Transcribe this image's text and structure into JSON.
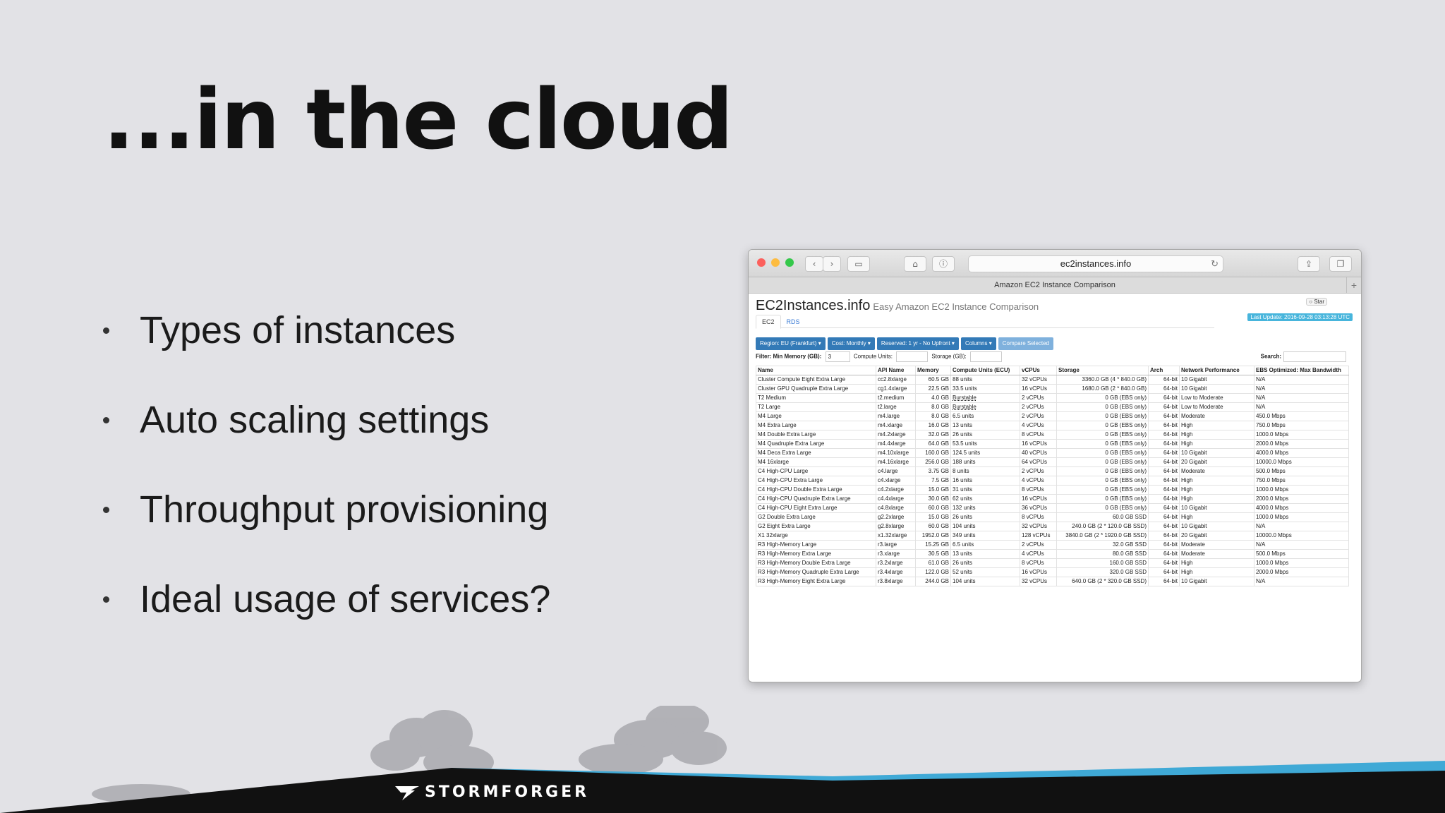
{
  "slide": {
    "title": "...in the cloud",
    "bullets": [
      "Types of instances",
      "Auto scaling settings",
      "Throughput provisioning",
      "Ideal usage of services?"
    ]
  },
  "browser": {
    "url": "ec2instances.info",
    "tab_title": "Amazon EC2 Instance Comparison",
    "site_title": "EC2Instances.info",
    "site_subtitle": "Easy Amazon EC2 Instance Comparison",
    "star_label": "Star",
    "last_update": "Last Update: 2016-09-28 03:13:28 UTC",
    "tabs": [
      "EC2",
      "RDS"
    ],
    "buttons": [
      "Region: EU (Frankfurt) ▾",
      "Cost: Monthly ▾",
      "Reserved: 1 yr - No Upfront ▾",
      "Columns ▾",
      "Compare Selected"
    ],
    "filter": {
      "label": "Filter: Min Memory (GB):",
      "min_memory_value": "3",
      "compute_units_label": "Compute Units:",
      "storage_label": "Storage (GB):",
      "search_label": "Search:"
    },
    "table": {
      "headers": [
        "Name",
        "API Name",
        "Memory",
        "Compute Units (ECU)",
        "vCPUs",
        "Storage",
        "Arch",
        "Network Performance",
        "EBS Optimized: Max Bandwidth"
      ],
      "rows": [
        [
          "Cluster Compute Eight Extra Large",
          "cc2.8xlarge",
          "60.5 GB",
          "88 units",
          "32 vCPUs",
          "3360.0 GB (4 * 840.0 GB)",
          "64-bit",
          "10 Gigabit",
          "N/A"
        ],
        [
          "Cluster GPU Quadruple Extra Large",
          "cg1.4xlarge",
          "22.5 GB",
          "33.5 units",
          "16 vCPUs",
          "1680.0 GB (2 * 840.0 GB)",
          "64-bit",
          "10 Gigabit",
          "N/A"
        ],
        [
          "T2 Medium",
          "t2.medium",
          "4.0 GB",
          "Burstable",
          "2 vCPUs",
          "0 GB (EBS only)",
          "64-bit",
          "Low to Moderate",
          "N/A"
        ],
        [
          "T2 Large",
          "t2.large",
          "8.0 GB",
          "Burstable",
          "2 vCPUs",
          "0 GB (EBS only)",
          "64-bit",
          "Low to Moderate",
          "N/A"
        ],
        [
          "M4 Large",
          "m4.large",
          "8.0 GB",
          "6.5 units",
          "2 vCPUs",
          "0 GB (EBS only)",
          "64-bit",
          "Moderate",
          "450.0 Mbps"
        ],
        [
          "M4 Extra Large",
          "m4.xlarge",
          "16.0 GB",
          "13 units",
          "4 vCPUs",
          "0 GB (EBS only)",
          "64-bit",
          "High",
          "750.0 Mbps"
        ],
        [
          "M4 Double Extra Large",
          "m4.2xlarge",
          "32.0 GB",
          "26 units",
          "8 vCPUs",
          "0 GB (EBS only)",
          "64-bit",
          "High",
          "1000.0 Mbps"
        ],
        [
          "M4 Quadruple Extra Large",
          "m4.4xlarge",
          "64.0 GB",
          "53.5 units",
          "16 vCPUs",
          "0 GB (EBS only)",
          "64-bit",
          "High",
          "2000.0 Mbps"
        ],
        [
          "M4 Deca Extra Large",
          "m4.10xlarge",
          "160.0 GB",
          "124.5 units",
          "40 vCPUs",
          "0 GB (EBS only)",
          "64-bit",
          "10 Gigabit",
          "4000.0 Mbps"
        ],
        [
          "M4 16xlarge",
          "m4.16xlarge",
          "256.0 GB",
          "188 units",
          "64 vCPUs",
          "0 GB (EBS only)",
          "64-bit",
          "20 Gigabit",
          "10000.0 Mbps"
        ],
        [
          "C4 High-CPU Large",
          "c4.large",
          "3.75 GB",
          "8 units",
          "2 vCPUs",
          "0 GB (EBS only)",
          "64-bit",
          "Moderate",
          "500.0 Mbps"
        ],
        [
          "C4 High-CPU Extra Large",
          "c4.xlarge",
          "7.5 GB",
          "16 units",
          "4 vCPUs",
          "0 GB (EBS only)",
          "64-bit",
          "High",
          "750.0 Mbps"
        ],
        [
          "C4 High-CPU Double Extra Large",
          "c4.2xlarge",
          "15.0 GB",
          "31 units",
          "8 vCPUs",
          "0 GB (EBS only)",
          "64-bit",
          "High",
          "1000.0 Mbps"
        ],
        [
          "C4 High-CPU Quadruple Extra Large",
          "c4.4xlarge",
          "30.0 GB",
          "62 units",
          "16 vCPUs",
          "0 GB (EBS only)",
          "64-bit",
          "High",
          "2000.0 Mbps"
        ],
        [
          "C4 High-CPU Eight Extra Large",
          "c4.8xlarge",
          "60.0 GB",
          "132 units",
          "36 vCPUs",
          "0 GB (EBS only)",
          "64-bit",
          "10 Gigabit",
          "4000.0 Mbps"
        ],
        [
          "G2 Double Extra Large",
          "g2.2xlarge",
          "15.0 GB",
          "26 units",
          "8 vCPUs",
          "60.0 GB SSD",
          "64-bit",
          "High",
          "1000.0 Mbps"
        ],
        [
          "G2 Eight Extra Large",
          "g2.8xlarge",
          "60.0 GB",
          "104 units",
          "32 vCPUs",
          "240.0 GB (2 * 120.0 GB SSD)",
          "64-bit",
          "10 Gigabit",
          "N/A"
        ],
        [
          "X1 32xlarge",
          "x1.32xlarge",
          "1952.0 GB",
          "349 units",
          "128 vCPUs",
          "3840.0 GB (2 * 1920.0 GB SSD)",
          "64-bit",
          "20 Gigabit",
          "10000.0 Mbps"
        ],
        [
          "R3 High-Memory Large",
          "r3.large",
          "15.25 GB",
          "6.5 units",
          "2 vCPUs",
          "32.0 GB SSD",
          "64-bit",
          "Moderate",
          "N/A"
        ],
        [
          "R3 High-Memory Extra Large",
          "r3.xlarge",
          "30.5 GB",
          "13 units",
          "4 vCPUs",
          "80.0 GB SSD",
          "64-bit",
          "Moderate",
          "500.0 Mbps"
        ],
        [
          "R3 High-Memory Double Extra Large",
          "r3.2xlarge",
          "61.0 GB",
          "26 units",
          "8 vCPUs",
          "160.0 GB SSD",
          "64-bit",
          "High",
          "1000.0 Mbps"
        ],
        [
          "R3 High-Memory Quadruple Extra Large",
          "r3.4xlarge",
          "122.0 GB",
          "52 units",
          "16 vCPUs",
          "320.0 GB SSD",
          "64-bit",
          "High",
          "2000.0 Mbps"
        ],
        [
          "R3 High-Memory Eight Extra Large",
          "r3.8xlarge",
          "244.0 GB",
          "104 units",
          "32 vCPUs",
          "640.0 GB (2 * 320.0 GB SSD)",
          "64-bit",
          "10 Gigabit",
          "N/A"
        ]
      ]
    }
  },
  "footer": {
    "brand": "STORMFORGER",
    "colors": {
      "band": "#111111",
      "accent": "#3fa9d6"
    }
  }
}
